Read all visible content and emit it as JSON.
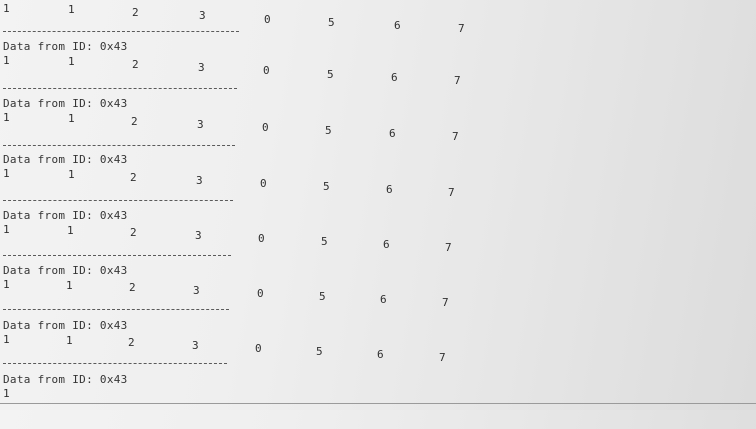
{
  "terminal": {
    "header_text": "Data from ID: 0x43",
    "blocks": [
      {
        "values": [
          "1",
          "1",
          "2",
          "3",
          "0",
          "5",
          "6",
          "7"
        ],
        "has_header": false
      },
      {
        "header": "Data from ID: 0x43",
        "values": [
          "1",
          "1",
          "2",
          "3",
          "0",
          "5",
          "6",
          "7"
        ]
      },
      {
        "header": "Data from ID: 0x43",
        "values": [
          "1",
          "1",
          "2",
          "3",
          "0",
          "5",
          "6",
          "7"
        ]
      },
      {
        "header": "Data from ID: 0x43",
        "values": [
          "1",
          "1",
          "2",
          "3",
          "0",
          "5",
          "6",
          "7"
        ]
      },
      {
        "header": "Data from ID: 0x43",
        "values": [
          "1",
          "1",
          "2",
          "3",
          "0",
          "5",
          "6",
          "7"
        ]
      },
      {
        "header": "Data from ID: 0x43",
        "values": [
          "1",
          "1",
          "2",
          "3",
          "0",
          "5",
          "6",
          "7"
        ]
      },
      {
        "header": "Data from ID: 0x43",
        "values": [
          "1",
          "1",
          "2",
          "3",
          "0",
          "5",
          "6",
          "7"
        ]
      },
      {
        "header": "Data from ID: 0x43",
        "values": [
          "1"
        ],
        "partial": true
      }
    ]
  }
}
